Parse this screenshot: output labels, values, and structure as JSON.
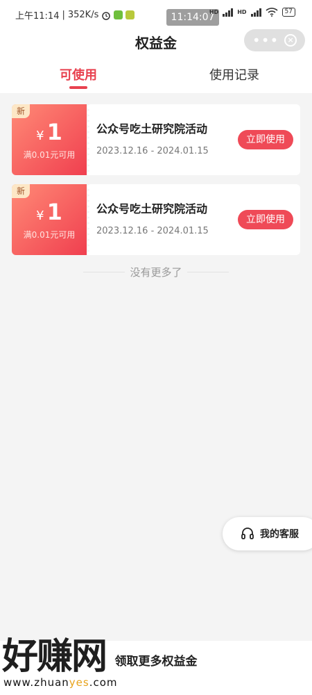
{
  "status_bar": {
    "time": "上午11:14",
    "speed": "352K/s",
    "overlay_time": "11:14:07",
    "battery": "57",
    "network_label": "HD"
  },
  "header": {
    "title": "权益金",
    "capsule_dots": "•••"
  },
  "tabs": [
    {
      "label": "可使用",
      "active": true
    },
    {
      "label": "使用记录",
      "active": false
    }
  ],
  "coupons": [
    {
      "badge": "新",
      "currency": "¥",
      "amount": "1",
      "condition": "满0.01元可用",
      "name": "公众号吃土研究院活动",
      "date": "2023.12.16 - 2024.01.15",
      "button": "立即使用"
    },
    {
      "badge": "新",
      "currency": "¥",
      "amount": "1",
      "condition": "满0.01元可用",
      "name": "公众号吃土研究院活动",
      "date": "2023.12.16 - 2024.01.15",
      "button": "立即使用"
    }
  ],
  "no_more": "没有更多了",
  "service": {
    "label": "我的客服",
    "icon": "headset-icon"
  },
  "bottom": {
    "label": "领取更多权益金"
  },
  "watermark": {
    "big": "好赚网",
    "url_a": "www.zhuan",
    "url_b": "yes",
    "url_c": ".com"
  },
  "colors": {
    "accent": "#e8414f",
    "coupon_start": "#ff8a76",
    "coupon_end": "#f03f4f",
    "badge_bg": "#fde7c6"
  }
}
